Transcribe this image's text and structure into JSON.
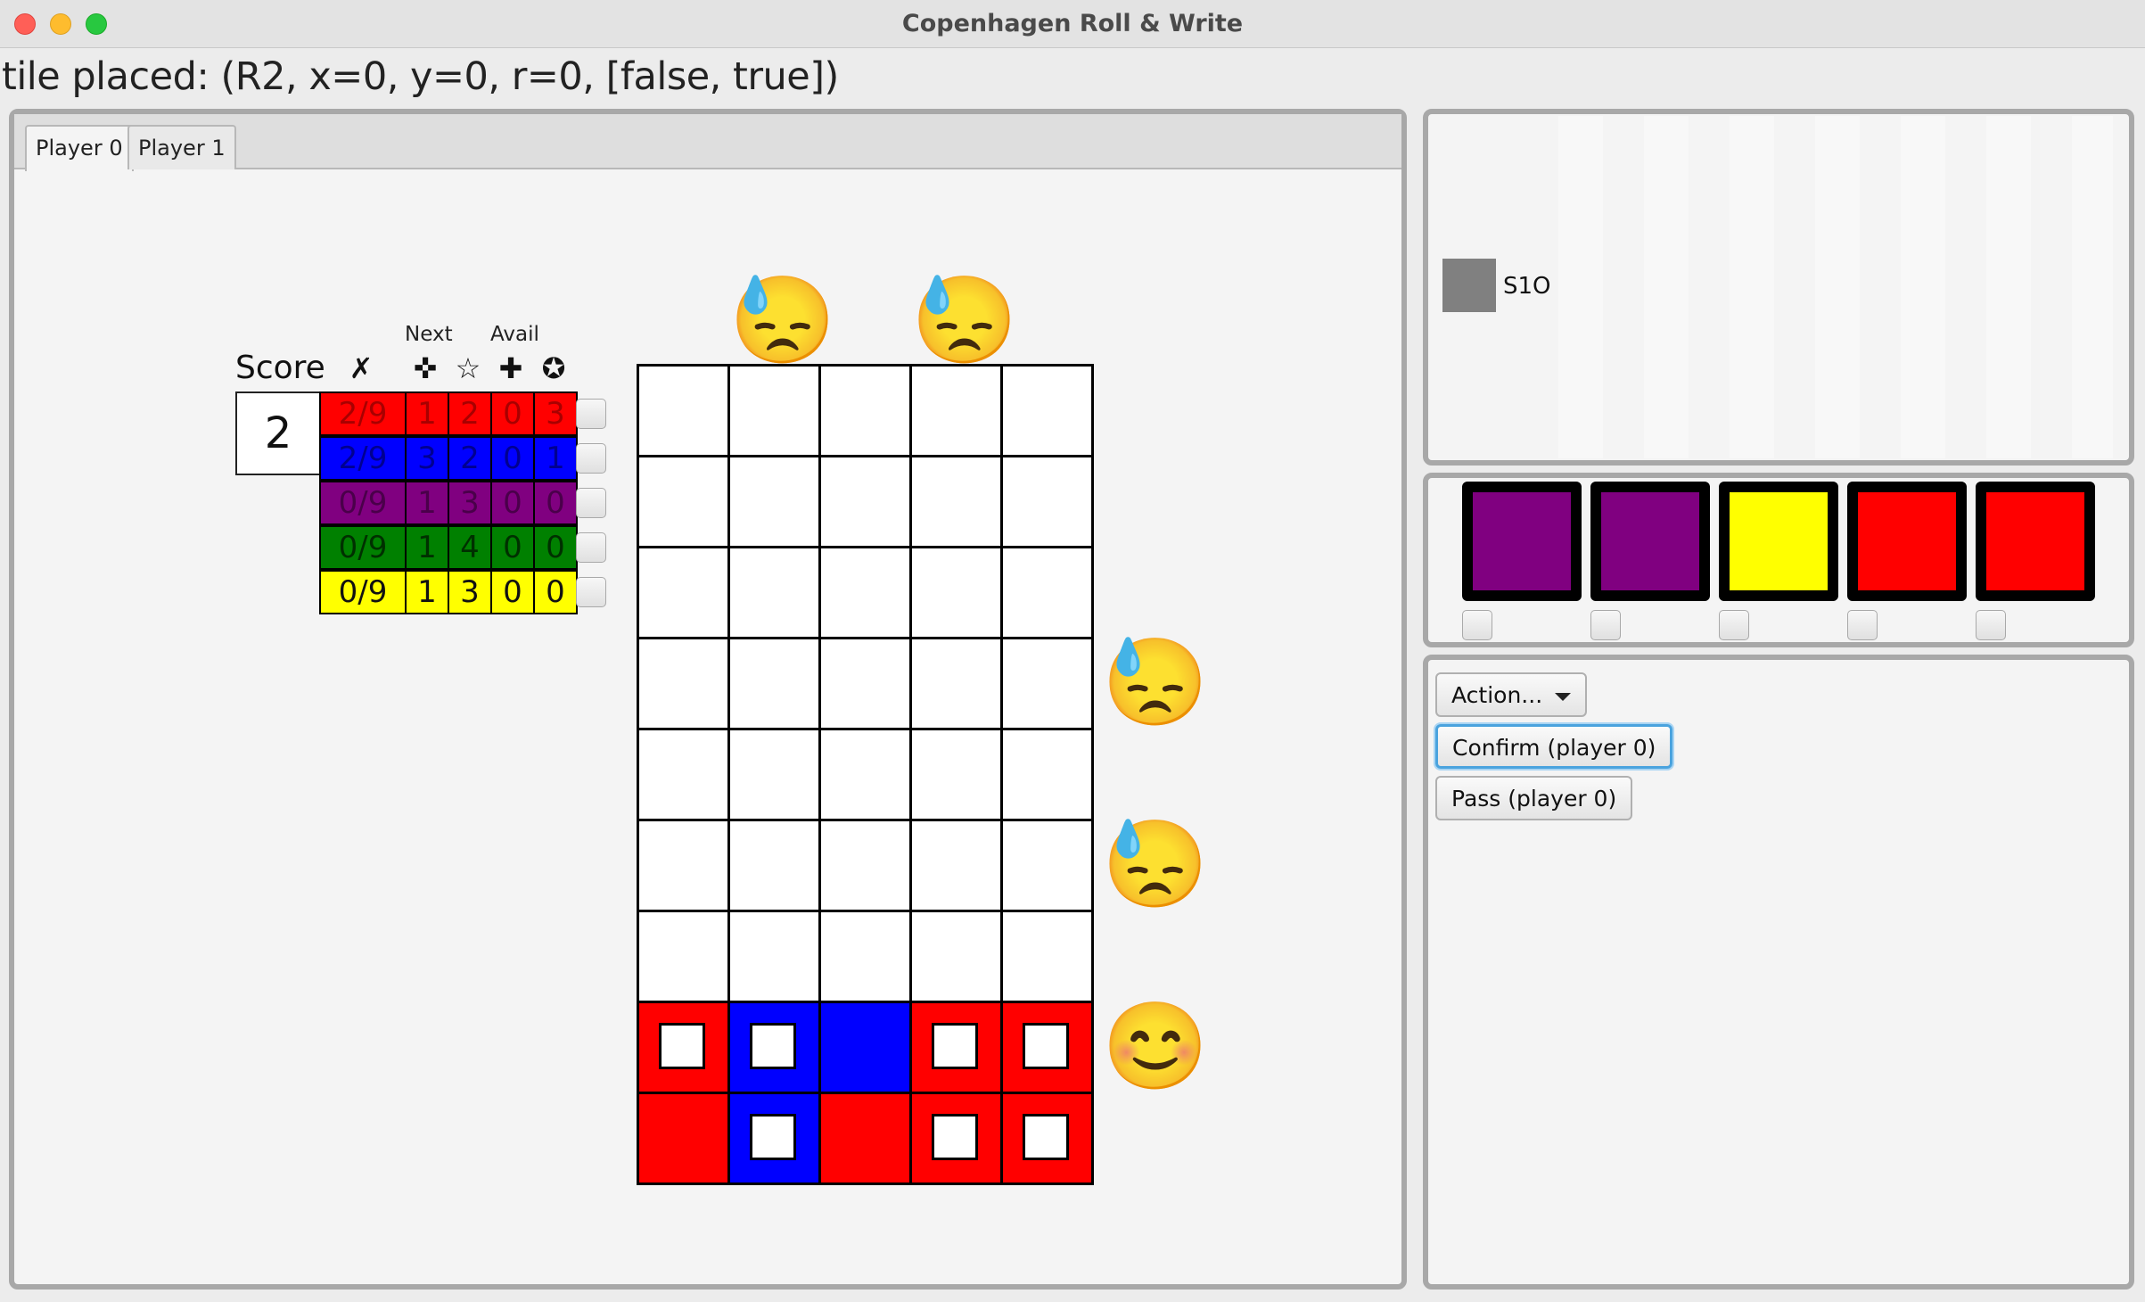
{
  "window": {
    "title": "Copenhagen Roll & Write",
    "controls": [
      "close",
      "minimize",
      "zoom"
    ]
  },
  "status": "tile placed: (R2, x=0, y=0, r=0, [false, true])",
  "tabs": [
    "Player 0",
    "Player 1"
  ],
  "active_tab": "Player 0",
  "score_sheet": {
    "score_label": "Score",
    "score_value": "2",
    "next_label": "Next",
    "avail_label": "Avail",
    "column_icons": [
      "cross-mark-icon",
      "move-cross-icon",
      "star-outline-icon",
      "plus-icon",
      "star-badge-icon"
    ],
    "column_symbols": [
      "✗",
      "✜",
      "☆",
      "✚",
      "✪"
    ],
    "rows": [
      {
        "color": "#ff0000",
        "text_color": "#a80000",
        "values": [
          "2/9",
          "1",
          "2",
          "0",
          "3"
        ]
      },
      {
        "color": "#0000ff",
        "text_color": "#000090",
        "values": [
          "2/9",
          "3",
          "2",
          "0",
          "1"
        ]
      },
      {
        "color": "#800080",
        "text_color": "#4a004a",
        "values": [
          "0/9",
          "1",
          "3",
          "0",
          "0"
        ]
      },
      {
        "color": "#008000",
        "text_color": "#003000",
        "values": [
          "0/9",
          "1",
          "4",
          "0",
          "0"
        ]
      },
      {
        "color": "#ffff00",
        "text_color": "#111111",
        "values": [
          "0/9",
          "1",
          "3",
          "0",
          "0"
        ]
      }
    ]
  },
  "board": {
    "rows": 9,
    "cols": 5,
    "cells": [
      [
        "white",
        "white",
        "white",
        "white",
        "white"
      ],
      [
        "white",
        "white",
        "white",
        "white",
        "white"
      ],
      [
        "white",
        "white",
        "white",
        "white",
        "white"
      ],
      [
        "white",
        "white",
        "white",
        "white",
        "white"
      ],
      [
        "white",
        "white",
        "white",
        "white",
        "white"
      ],
      [
        "white",
        "white",
        "white",
        "white",
        "white"
      ],
      [
        "white",
        "white",
        "white",
        "white",
        "white"
      ],
      [
        "red-window",
        "blue-window",
        "blue",
        "red-window",
        "red-window"
      ],
      [
        "red",
        "blue-window",
        "red",
        "red-window",
        "red-window"
      ]
    ],
    "column_emojis": [
      "",
      "😓",
      "",
      "😓",
      ""
    ],
    "row_emojis": [
      "",
      "",
      "",
      "😓",
      "",
      "😓",
      "",
      "😊",
      ""
    ],
    "emoji_icons": {
      "sad": "sleepy-sweat-face-icon",
      "happy": "smiling-face-icon"
    }
  },
  "selected_die": {
    "color": "#808080",
    "label": "S1O"
  },
  "dice_pool": [
    "#800080",
    "#800080",
    "#ffff00",
    "#ff0000",
    "#ff0000"
  ],
  "actions": {
    "dropdown_label": "Action...",
    "confirm_label": "Confirm (player 0)",
    "pass_label": "Pass (player 0)"
  }
}
